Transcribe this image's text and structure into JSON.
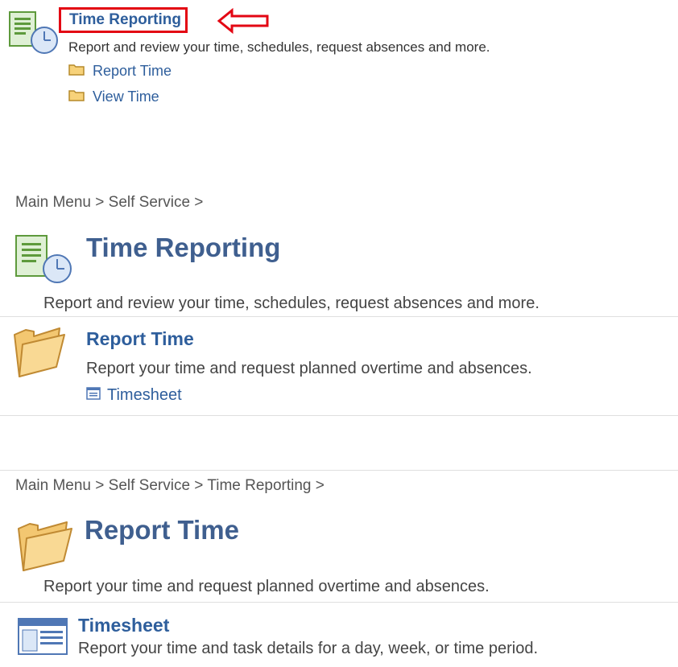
{
  "section1": {
    "title": "Time Reporting",
    "description": "Report and review your time, schedules, request absences and more.",
    "items": [
      {
        "label": "Report Time"
      },
      {
        "label": "View Time"
      }
    ]
  },
  "section2": {
    "breadcrumb": "Main Menu > Self Service >",
    "title": "Time Reporting",
    "description": "Report and review your time, schedules, request absences and more.",
    "sub": {
      "title": "Report Time",
      "description": "Report your time and request planned overtime and absences.",
      "link": "Timesheet"
    }
  },
  "section3": {
    "breadcrumb": "Main Menu > Self Service > Time Reporting >",
    "title": "Report Time",
    "description": "Report your time and request planned overtime and absences.",
    "sub": {
      "title": "Timesheet",
      "description": "Report your time and task details for a day, week, or time period."
    }
  },
  "colors": {
    "link": "#2e5e9c",
    "title": "#3f5f8f",
    "highlight_border": "#e30613"
  },
  "icons": [
    "time-reporting-icon",
    "folder-icon",
    "timesheet-icon",
    "red-arrow-icon"
  ]
}
